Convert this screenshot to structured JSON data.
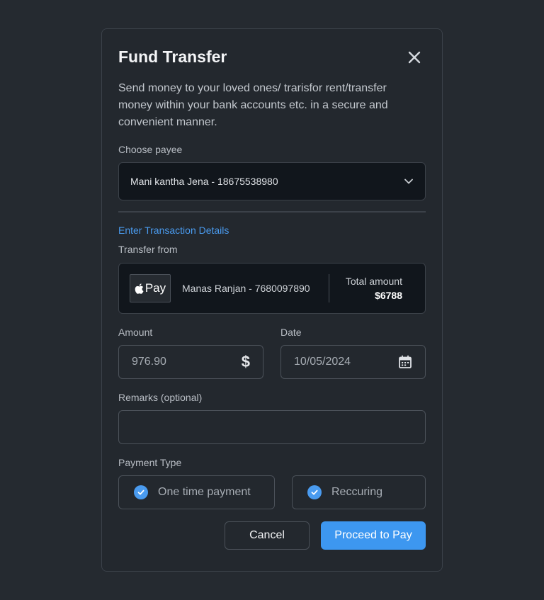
{
  "modal": {
    "title": "Fund Transfer",
    "description": "Send money to your loved ones/ trarisfor rent/transfer money within your bank accounts etc. in a secure and convenient manner."
  },
  "payee": {
    "label": "Choose payee",
    "selected": "Mani kantha Jena - 18675538980"
  },
  "section_title": "Enter Transaction Details",
  "transfer_from": {
    "label": "Transfer from",
    "wallet_logo": "Pay",
    "account": "Manas Ranjan - 7680097890",
    "total_label": "Total amount",
    "total_value": "$6788"
  },
  "amount": {
    "label": "Amount",
    "value": "976.90"
  },
  "date": {
    "label": "Date",
    "value": "10/05/2024"
  },
  "remarks": {
    "label": "Remarks (optional)",
    "value": ""
  },
  "payment_type": {
    "label": "Payment Type",
    "options": [
      {
        "label": "One time payment",
        "checked": true
      },
      {
        "label": "Reccuring",
        "checked": true
      }
    ]
  },
  "buttons": {
    "cancel": "Cancel",
    "proceed": "Proceed to Pay"
  },
  "colors": {
    "accent": "#3d97f0",
    "link": "#4a9bef",
    "background": "#252a30"
  }
}
